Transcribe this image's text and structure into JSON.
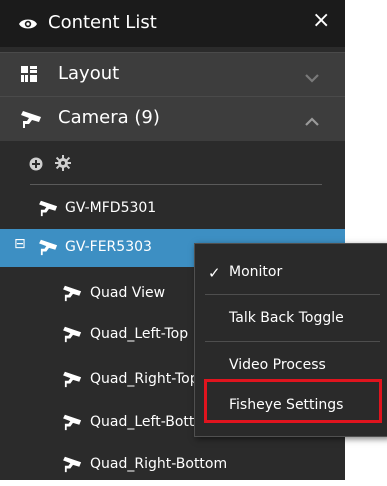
{
  "header": {
    "title": "Content List",
    "close_symbol": "×",
    "eye_icon": "eye-icon"
  },
  "sections": {
    "layout": {
      "label": "Layout",
      "icon": "layout-grid-icon",
      "chevron": "chevron-down-icon"
    },
    "camera": {
      "label": "Camera (9)",
      "icon": "camera-icon",
      "chevron": "chevron-up-icon"
    }
  },
  "toolbar": {
    "add_icon": "add-circle-icon",
    "settings_icon": "gear-icon"
  },
  "tree": {
    "devices": [
      {
        "label": "GV-MFD5301"
      },
      {
        "label": "GV-FER5303",
        "expand_symbol": "⊟"
      }
    ],
    "children": [
      {
        "label": "Quad View"
      },
      {
        "label": "Quad_Left-Top"
      },
      {
        "label": "Quad_Right-Top"
      },
      {
        "label": "Quad_Left-Bottom"
      },
      {
        "label": "Quad_Right-Bottom"
      }
    ]
  },
  "context_menu": {
    "items": [
      {
        "label": "Monitor",
        "checked": true,
        "check_symbol": "✓"
      },
      {
        "label": "Talk Back Toggle"
      },
      {
        "label": "Video Process"
      },
      {
        "label": "Fisheye Settings"
      }
    ]
  },
  "colors": {
    "selected_row": "#3d8fc3",
    "highlight_box": "#e0141e",
    "panel_bg": "#2b2b2b"
  }
}
